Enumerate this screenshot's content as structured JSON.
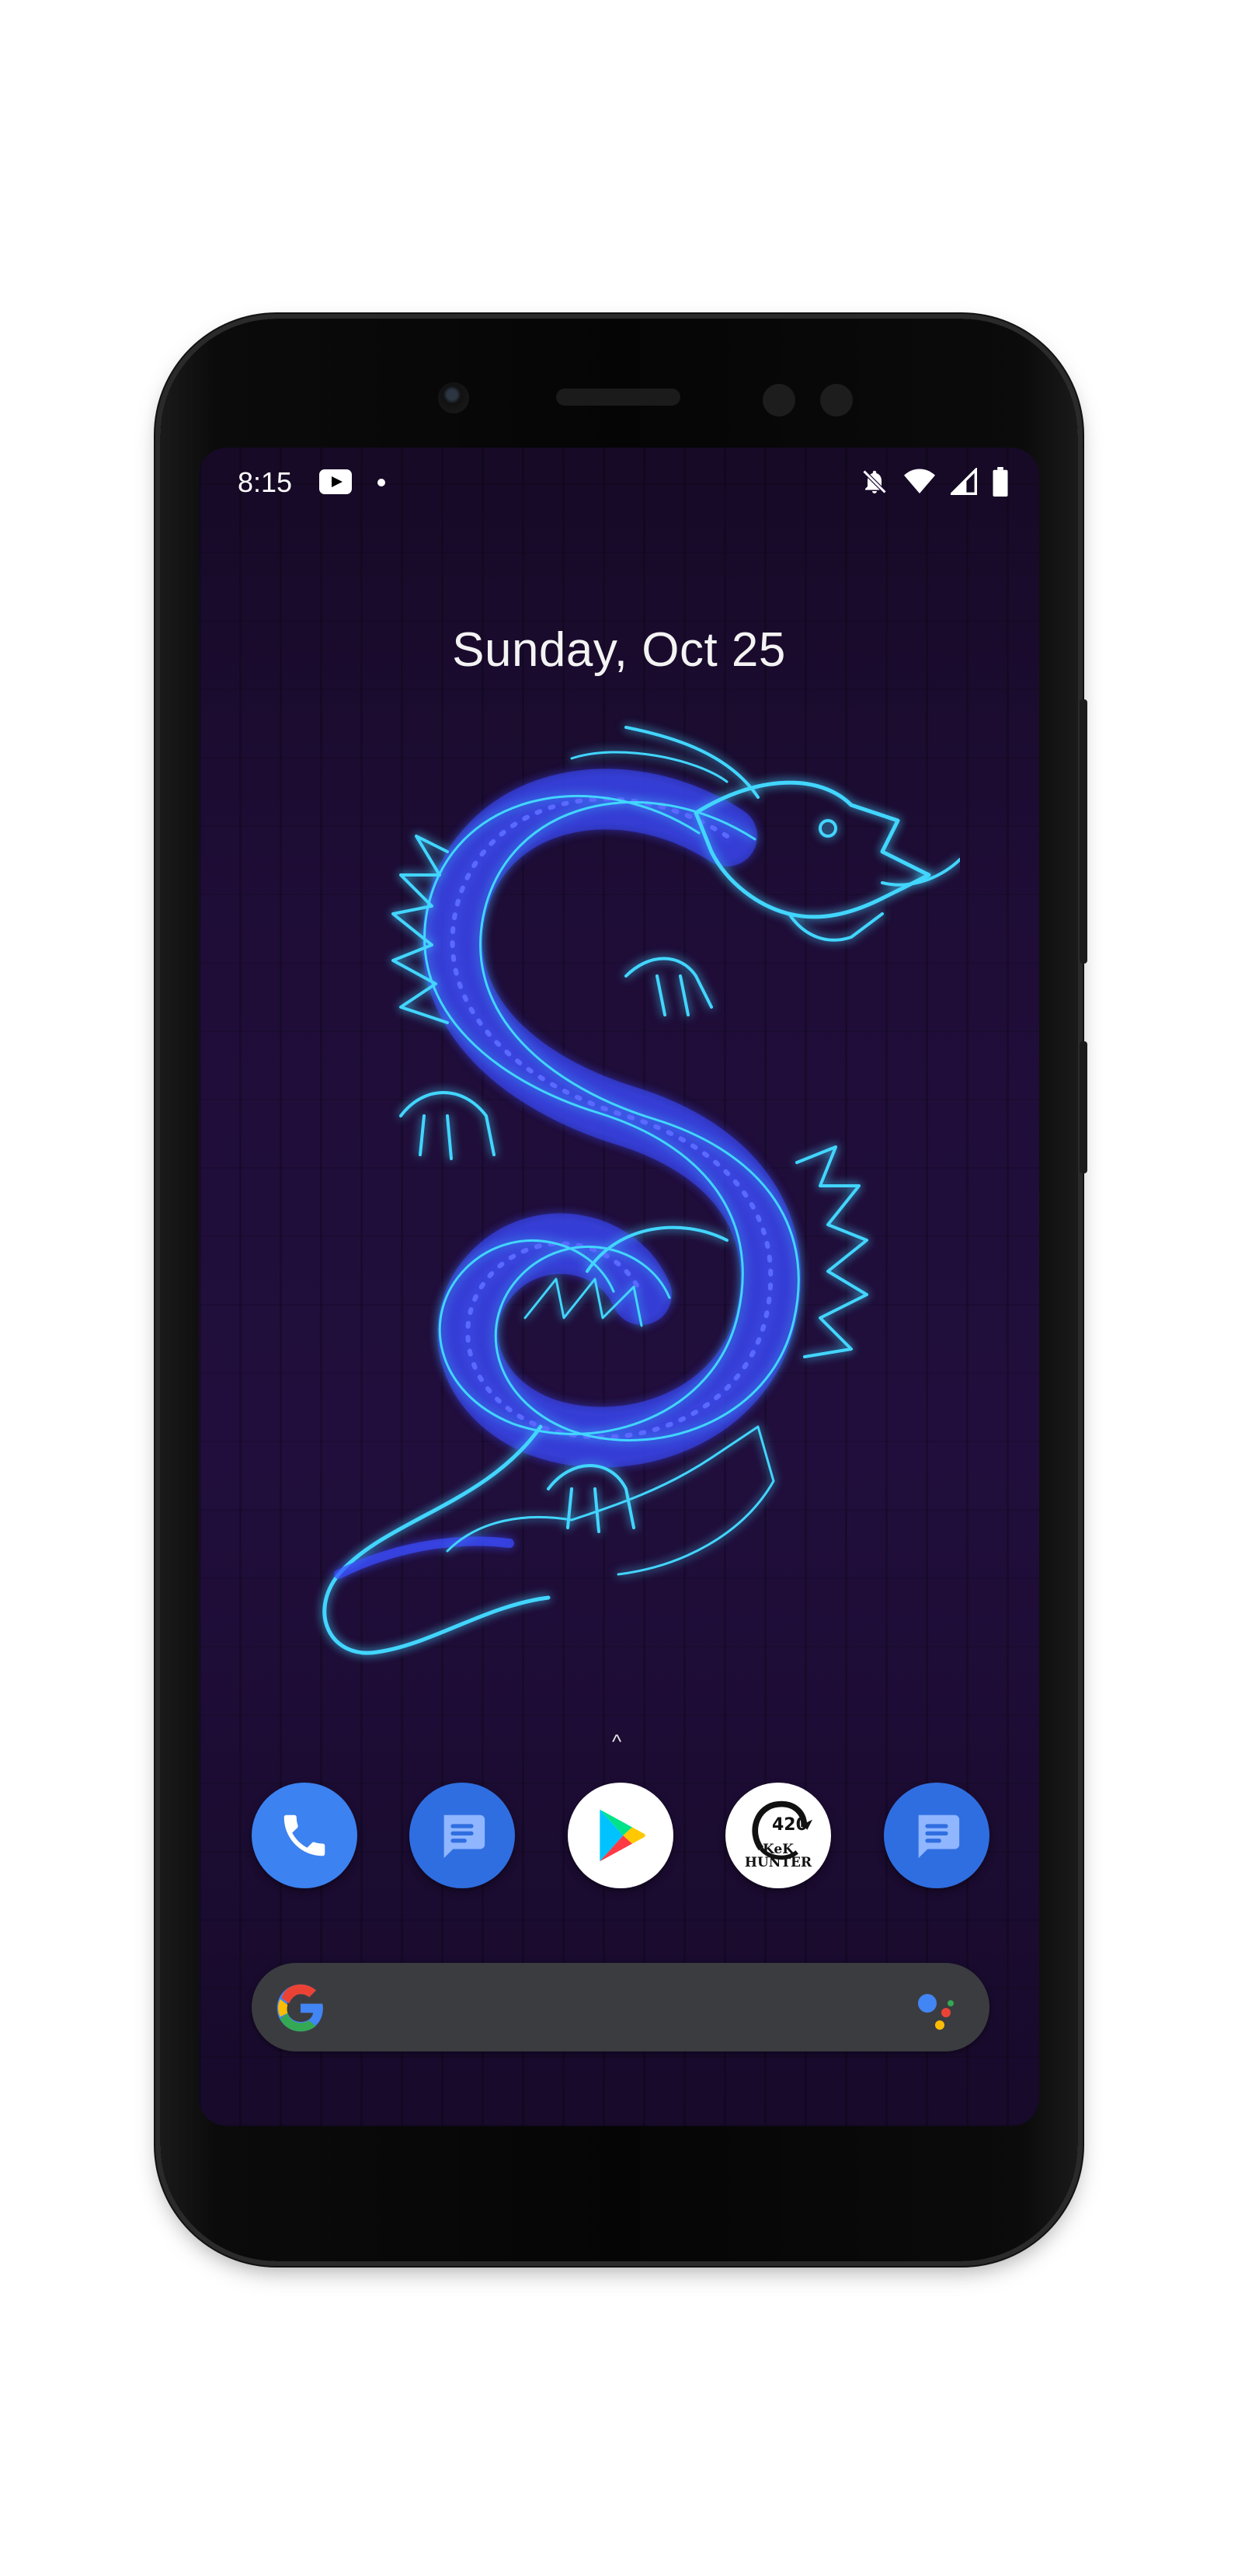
{
  "status_bar": {
    "time": "8:15",
    "left_icons": [
      "youtube-icon",
      "notification-dot"
    ],
    "right_icons": [
      "do-not-disturb-icon",
      "wifi-icon",
      "cell-signal-icon",
      "battery-icon"
    ]
  },
  "home": {
    "date": "Sunday, Oct 25",
    "swipe_hint": "^",
    "wallpaper": "neon blue dragon on purple brick wall"
  },
  "dock": {
    "apps": [
      {
        "name": "Phone",
        "icon": "phone-icon"
      },
      {
        "name": "Messages",
        "icon": "messages-icon"
      },
      {
        "name": "Play Store",
        "icon": "play-store-icon"
      },
      {
        "name": "KeK Hunter",
        "icon": "kek-hunter-icon",
        "badge_number": "420",
        "label_lines": [
          "KeK",
          "HUNTER"
        ]
      },
      {
        "name": "Messages",
        "icon": "messages-icon"
      }
    ]
  },
  "search": {
    "google_icon": "google-g-icon",
    "assistant_icon": "assistant-icon"
  },
  "colors": {
    "accent_blue": "#2f6ee0",
    "phone_blue": "#3c82f0",
    "search_bar": "#3b3c40",
    "dragon_blue": "#3a4bff",
    "dragon_cyan": "#42d6ff"
  }
}
